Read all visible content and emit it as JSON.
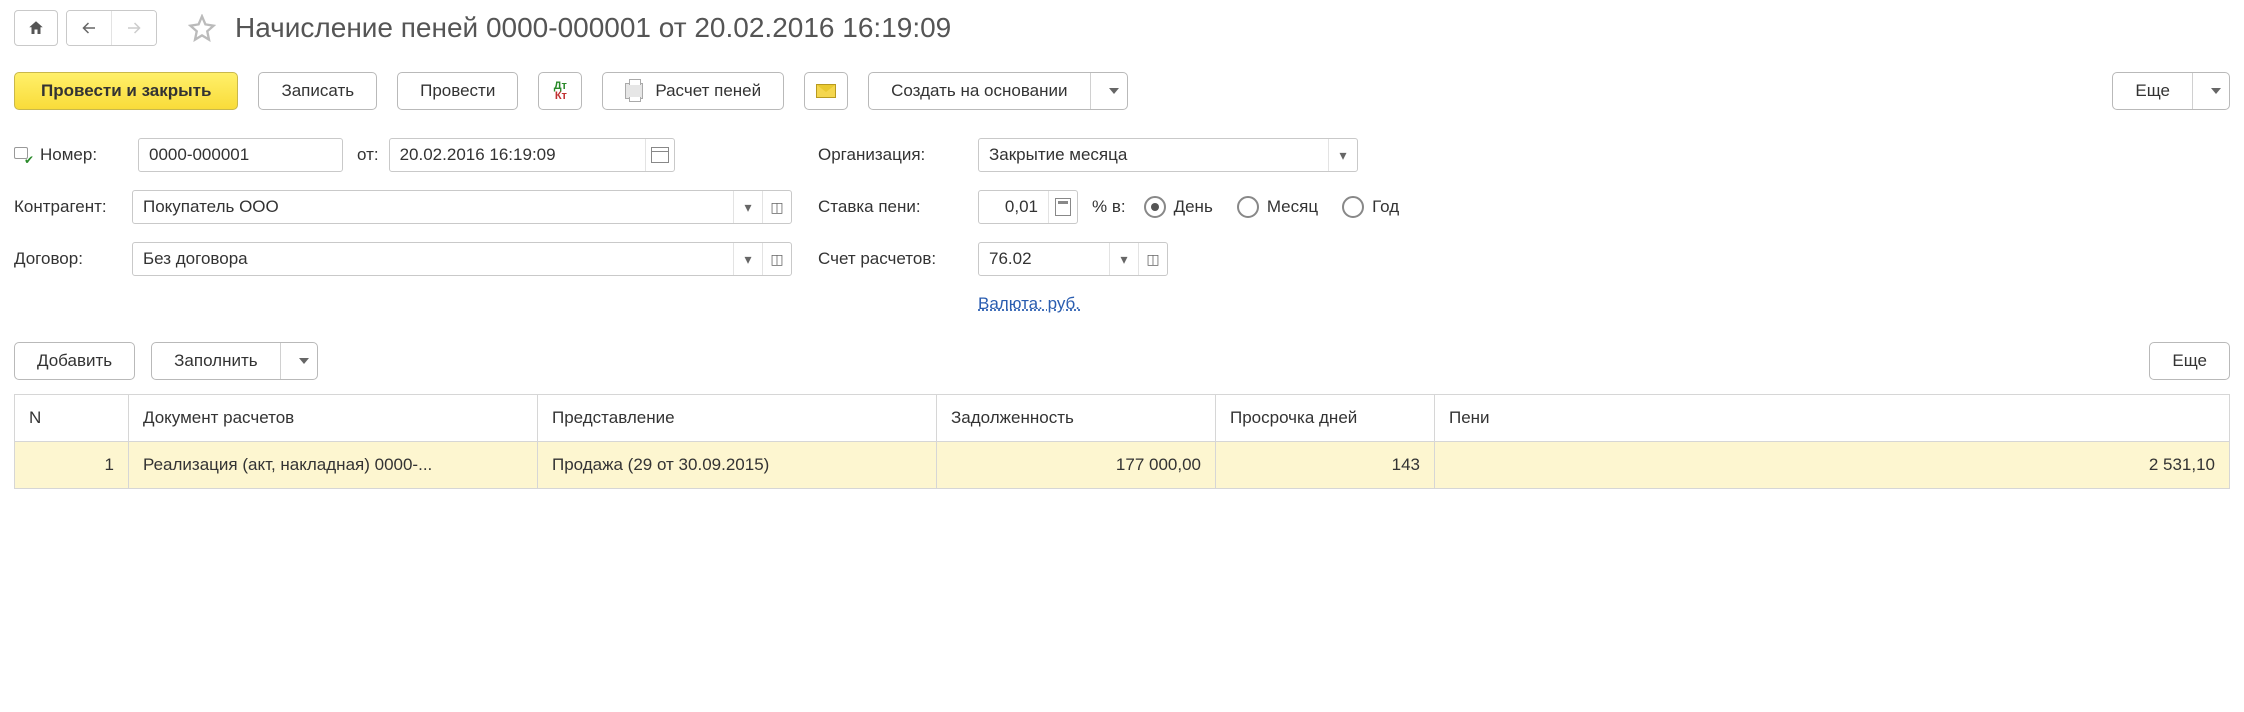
{
  "header": {
    "title": "Начисление пеней 0000-000001 от 20.02.2016 16:19:09"
  },
  "toolbar": {
    "post_and_close": "Провести и закрыть",
    "save": "Записать",
    "post": "Провести",
    "calc_penalties": "Расчет пеней",
    "create_based": "Создать на основании",
    "more": "Еще"
  },
  "form": {
    "number_label": "Номер:",
    "number_value": "0000-000001",
    "from_label": "от:",
    "from_value": "20.02.2016 16:19:09",
    "counterparty_label": "Контрагент:",
    "counterparty_value": "Покупатель ООО",
    "contract_label": "Договор:",
    "contract_value": "Без договора",
    "organization_label": "Организация:",
    "organization_value": "Закрытие месяца",
    "rate_label": "Ставка пени:",
    "rate_value": "0,01",
    "rate_unit_label": "% в:",
    "rate_period_day": "День",
    "rate_period_month": "Месяц",
    "rate_period_year": "Год",
    "account_label": "Счет расчетов:",
    "account_value": "76.02",
    "currency_link": "Валюта: руб."
  },
  "table_toolbar": {
    "add": "Добавить",
    "fill": "Заполнить",
    "more": "Еще"
  },
  "table": {
    "headers": {
      "n": "N",
      "doc": "Документ расчетов",
      "rep": "Представление",
      "debt": "Задолженность",
      "days": "Просрочка дней",
      "pen": "Пени"
    },
    "rows": [
      {
        "n": "1",
        "doc": "Реализация (акт, накладная) 0000-...",
        "rep": "Продажа (29 от 30.09.2015)",
        "debt": "177 000,00",
        "days": "143",
        "pen": "2 531,10"
      }
    ]
  }
}
